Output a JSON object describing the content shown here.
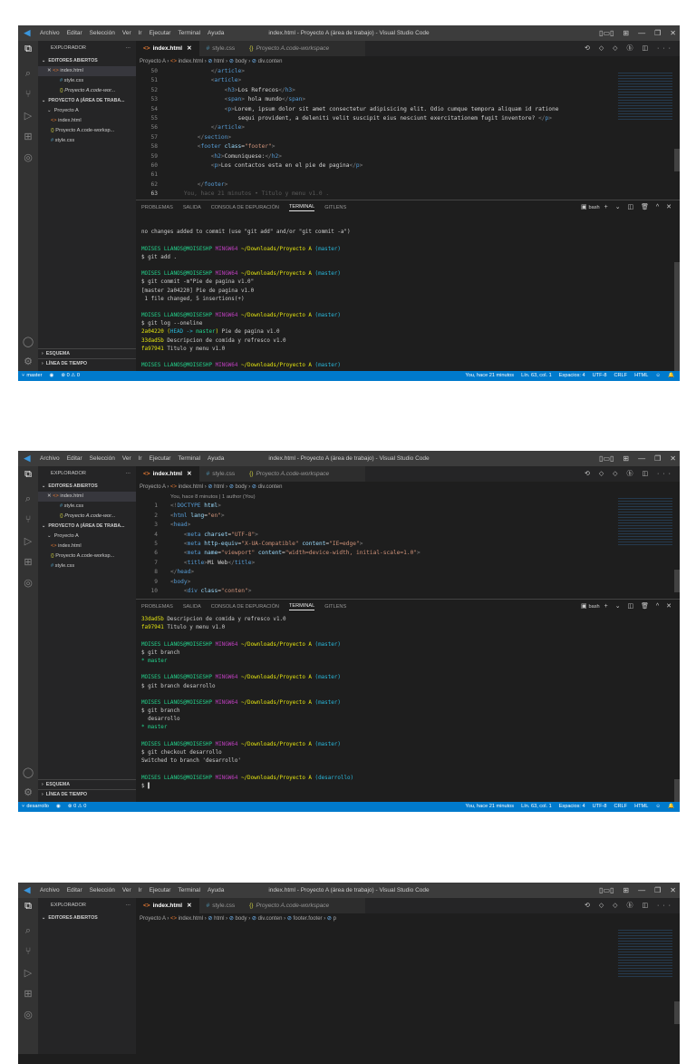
{
  "common": {
    "menu": [
      "Archivo",
      "Editar",
      "Selección",
      "Ver",
      "Ir",
      "Ejecutar",
      "Terminal",
      "Ayuda"
    ],
    "title": "index.html - Proyecto A (área de trabajo) - Visual Studio Code",
    "window_controls": [
      "▯▭▯",
      "⊞",
      "—",
      "❐",
      "✕"
    ],
    "tabs": [
      {
        "label": "index.html",
        "close": "✕",
        "icon": "<>"
      },
      {
        "label": "style.css",
        "icon": "#"
      },
      {
        "label": "Proyecto A.code-workspace",
        "icon": "{}"
      }
    ],
    "tab_actions": "⟲ ◇ ◇ ⓑ ◫ ···",
    "sidebar": {
      "explorer_title": "EXPLORADOR",
      "more": "···",
      "open_editors": "EDITORES ABIERTOS",
      "open_files": [
        "index.html",
        "style.css",
        "Proyecto A.code-wor..."
      ],
      "workspace": "PROYECTO A (ÁREA DE TRABA...",
      "folder": "Proyecto A",
      "folder_files": [
        "index.html",
        "Proyecto A.code-worksp...",
        "style.css"
      ],
      "outline": "ESQUEMA",
      "timeline": "LÍNEA DE TIEMPO"
    },
    "panel_tabs": [
      "PROBLEMAS",
      "SALIDA",
      "CONSOLA DE DEPURACIÓN",
      "TERMINAL",
      "GITLENS"
    ],
    "shell": "bash",
    "panel_actions": "+ ⌄ ◫ 🗑 ^ ✕",
    "status": {
      "errors": "⊗ 0 ⚠ 0",
      "blame": "You, hace 21 minutos",
      "position": "Lín. 63, col. 1",
      "spaces": "Espacios: 4",
      "encoding": "UTF-8",
      "eol": "CRLF",
      "language": "HTML"
    },
    "colors": {
      "status_bar": "#007acc",
      "titlebar": "#3c3c3c",
      "editor_bg": "#1e1e1e",
      "sidebar_bg": "#252526"
    }
  },
  "windows": [
    {
      "breadcrumb": [
        "Proyecto A",
        "index.html",
        "html",
        "body",
        "div.conten"
      ],
      "branch": "master",
      "code_header": "",
      "code": [
        {
          "n": "50",
          "s": [
            [
              "            </",
              "b"
            ],
            [
              "article",
              "t"
            ],
            [
              ">",
              "b"
            ]
          ]
        },
        {
          "n": "51",
          "s": [
            [
              "            <",
              "b"
            ],
            [
              "article",
              "t"
            ],
            [
              ">",
              "b"
            ]
          ]
        },
        {
          "n": "52",
          "s": [
            [
              "                <",
              "b"
            ],
            [
              "h3",
              "t"
            ],
            [
              ">",
              "b"
            ],
            [
              "Los Refrecos",
              "x"
            ],
            [
              "</",
              "b"
            ],
            [
              "h3",
              "t"
            ],
            [
              ">",
              "b"
            ]
          ]
        },
        {
          "n": "53",
          "s": [
            [
              "                <",
              "b"
            ],
            [
              "span",
              "t"
            ],
            [
              ">",
              "b"
            ],
            [
              " hola mundo",
              "x"
            ],
            [
              "</",
              "b"
            ],
            [
              "span",
              "t"
            ],
            [
              ">",
              "b"
            ]
          ]
        },
        {
          "n": "54",
          "s": [
            [
              "                <",
              "b"
            ],
            [
              "p",
              "t"
            ],
            [
              ">",
              "b"
            ],
            [
              "Lorem, ipsum dolor sit amet consectetur adipisicing elit. Odio cumque tempora aliquam id ratione",
              "x"
            ]
          ]
        },
        {
          "n": "55",
          "s": [
            [
              "                    sequi provident, a deleniti velit suscipit eius nesciunt exercitationem fugit inventore? ",
              "x"
            ],
            [
              "</",
              "b"
            ],
            [
              "p",
              "t"
            ],
            [
              ">",
              "b"
            ]
          ]
        },
        {
          "n": "56",
          "s": [
            [
              "            </",
              "b"
            ],
            [
              "article",
              "t"
            ],
            [
              ">",
              "b"
            ]
          ]
        },
        {
          "n": "57",
          "s": [
            [
              "        </",
              "b"
            ],
            [
              "section",
              "t"
            ],
            [
              ">",
              "b"
            ]
          ]
        },
        {
          "n": "58",
          "s": [
            [
              "        <",
              "b"
            ],
            [
              "footer",
              "t"
            ],
            [
              " class",
              "a"
            ],
            [
              "=",
              "x"
            ],
            [
              "\"footer\"",
              "s"
            ],
            [
              ">",
              "b"
            ]
          ]
        },
        {
          "n": "59",
          "s": [
            [
              "            <",
              "b"
            ],
            [
              "h2",
              "t"
            ],
            [
              ">",
              "b"
            ],
            [
              "Comuniquese:",
              "x"
            ],
            [
              "</",
              "b"
            ],
            [
              "h2",
              "t"
            ],
            [
              ">",
              "b"
            ]
          ]
        },
        {
          "n": "60",
          "s": [
            [
              "            <",
              "b"
            ],
            [
              "p",
              "t"
            ],
            [
              ">",
              "b"
            ],
            [
              "Los contactos esta en el pie de pagina",
              "x"
            ],
            [
              "</",
              "b"
            ],
            [
              "p",
              "t"
            ],
            [
              ">",
              "b"
            ]
          ]
        },
        {
          "n": "61",
          "s": []
        },
        {
          "n": "62",
          "s": [
            [
              "        </",
              "b"
            ],
            [
              "footer",
              "t"
            ],
            [
              ">",
              "b"
            ]
          ]
        },
        {
          "n": "63",
          "s": [
            [
              "    You, hace 21 minutos • Titulo y menu v1.0 .",
              "gh"
            ]
          ]
        }
      ],
      "terminal": [
        [],
        [
          [
            "no changes added to commit (use \"git add\" and/or \"git commit -a\")",
            "w"
          ]
        ],
        [],
        [
          [
            "MOISES LLANOS@MOISESHP ",
            "g"
          ],
          [
            "MINGW64 ",
            "m"
          ],
          [
            "~/Downloads/Proyecto A ",
            "y"
          ],
          [
            "(master)",
            "c"
          ]
        ],
        [
          [
            "$ git add .",
            "w"
          ]
        ],
        [],
        [
          [
            "MOISES LLANOS@MOISESHP ",
            "g"
          ],
          [
            "MINGW64 ",
            "m"
          ],
          [
            "~/Downloads/Proyecto A ",
            "y"
          ],
          [
            "(master)",
            "c"
          ]
        ],
        [
          [
            "$ git commit -m\"Pie de pagina v1.0\"",
            "w"
          ]
        ],
        [
          [
            "[master 2a04220] Pie de pagina v1.0",
            "w"
          ]
        ],
        [
          [
            " 1 file changed, 5 insertions(+)",
            "w"
          ]
        ],
        [],
        [
          [
            "MOISES LLANOS@MOISESHP ",
            "g"
          ],
          [
            "MINGW64 ",
            "m"
          ],
          [
            "~/Downloads/Proyecto A ",
            "y"
          ],
          [
            "(master)",
            "c"
          ]
        ],
        [
          [
            "$ git log --oneline",
            "w"
          ]
        ],
        [
          [
            "2a04220",
            "h"
          ],
          [
            " (",
            "y"
          ],
          [
            "HEAD -> ",
            "c"
          ],
          [
            "master",
            "g"
          ],
          [
            ")",
            "y"
          ],
          [
            " Pie de pagina v1.0",
            "w"
          ]
        ],
        [
          [
            "33dad5b",
            "h"
          ],
          [
            " Descripcion de comida y refresco v1.0",
            "w"
          ]
        ],
        [
          [
            "fa97941",
            "h"
          ],
          [
            " Titulo y menu v1.0",
            "w"
          ]
        ],
        [],
        [
          [
            "MOISES LLANOS@MOISESHP ",
            "g"
          ],
          [
            "MINGW64 ",
            "m"
          ],
          [
            "~/Downloads/Proyecto A ",
            "y"
          ],
          [
            "(master)",
            "c"
          ]
        ]
      ]
    },
    {
      "breadcrumb": [
        "Proyecto A",
        "index.html",
        "html",
        "body",
        "div.conten"
      ],
      "branch": "desarrollo",
      "code_header": "You, hace 8 minutos | 1 author (You)",
      "code": [
        {
          "n": "1",
          "s": [
            [
              "<!",
              "b"
            ],
            [
              "DOCTYPE",
              "t"
            ],
            [
              " html",
              "k"
            ],
            [
              ">",
              "b"
            ]
          ]
        },
        {
          "n": "2",
          "s": [
            [
              "<",
              "b"
            ],
            [
              "html",
              "t"
            ],
            [
              " lang",
              "a"
            ],
            [
              "=",
              "x"
            ],
            [
              "\"en\"",
              "s"
            ],
            [
              ">",
              "b"
            ]
          ]
        },
        {
          "n": "3",
          "s": [
            [
              "<",
              "b"
            ],
            [
              "head",
              "t"
            ],
            [
              ">",
              "b"
            ]
          ]
        },
        {
          "n": "4",
          "s": [
            [
              "    <",
              "b"
            ],
            [
              "meta",
              "t"
            ],
            [
              " charset",
              "a"
            ],
            [
              "=",
              "x"
            ],
            [
              "\"UTF-8\"",
              "s"
            ],
            [
              ">",
              "b"
            ]
          ]
        },
        {
          "n": "5",
          "s": [
            [
              "    <",
              "b"
            ],
            [
              "meta",
              "t"
            ],
            [
              " http-equiv",
              "a"
            ],
            [
              "=",
              "x"
            ],
            [
              "\"X-UA-Compatible\"",
              "s"
            ],
            [
              " content",
              "a"
            ],
            [
              "=",
              "x"
            ],
            [
              "\"IE=edge\"",
              "s"
            ],
            [
              ">",
              "b"
            ]
          ]
        },
        {
          "n": "6",
          "s": [
            [
              "    <",
              "b"
            ],
            [
              "meta",
              "t"
            ],
            [
              " name",
              "a"
            ],
            [
              "=",
              "x"
            ],
            [
              "\"viewport\"",
              "s"
            ],
            [
              " content",
              "a"
            ],
            [
              "=",
              "x"
            ],
            [
              "\"width=device-width, initial-scale=1.0\"",
              "s"
            ],
            [
              ">",
              "b"
            ]
          ]
        },
        {
          "n": "7",
          "s": [
            [
              "    <",
              "b"
            ],
            [
              "title",
              "t"
            ],
            [
              ">",
              "b"
            ],
            [
              "Mi Web",
              "x"
            ],
            [
              "</",
              "b"
            ],
            [
              "title",
              "t"
            ],
            [
              ">",
              "b"
            ]
          ]
        },
        {
          "n": "8",
          "s": [
            [
              "</",
              "b"
            ],
            [
              "head",
              "t"
            ],
            [
              ">",
              "b"
            ]
          ]
        },
        {
          "n": "9",
          "s": [
            [
              "<",
              "b"
            ],
            [
              "body",
              "t"
            ],
            [
              ">",
              "b"
            ]
          ]
        },
        {
          "n": "10",
          "s": [
            [
              "    <",
              "b"
            ],
            [
              "div",
              "t"
            ],
            [
              " class",
              "a"
            ],
            [
              "=",
              "x"
            ],
            [
              "\"conten\"",
              "s"
            ],
            [
              ">",
              "b"
            ]
          ]
        }
      ],
      "terminal": [
        [
          [
            "33dad5b",
            "h"
          ],
          [
            " Descripcion de comida y refresco v1.0",
            "w"
          ]
        ],
        [
          [
            "fa97941",
            "h"
          ],
          [
            " Titulo y menu v1.0",
            "w"
          ]
        ],
        [],
        [
          [
            "MOISES LLANOS@MOISESHP ",
            "g"
          ],
          [
            "MINGW64 ",
            "m"
          ],
          [
            "~/Downloads/Proyecto A ",
            "y"
          ],
          [
            "(master)",
            "c"
          ]
        ],
        [
          [
            "$ git branch",
            "w"
          ]
        ],
        [
          [
            "* master",
            "grn"
          ]
        ],
        [],
        [
          [
            "MOISES LLANOS@MOISESHP ",
            "g"
          ],
          [
            "MINGW64 ",
            "m"
          ],
          [
            "~/Downloads/Proyecto A ",
            "y"
          ],
          [
            "(master)",
            "c"
          ]
        ],
        [
          [
            "$ git branch desarrollo",
            "w"
          ]
        ],
        [],
        [
          [
            "MOISES LLANOS@MOISESHP ",
            "g"
          ],
          [
            "MINGW64 ",
            "m"
          ],
          [
            "~/Downloads/Proyecto A ",
            "y"
          ],
          [
            "(master)",
            "c"
          ]
        ],
        [
          [
            "$ git branch",
            "w"
          ]
        ],
        [
          [
            "  desarrollo",
            "w"
          ]
        ],
        [
          [
            "* master",
            "grn"
          ]
        ],
        [],
        [
          [
            "MOISES LLANOS@MOISESHP ",
            "g"
          ],
          [
            "MINGW64 ",
            "m"
          ],
          [
            "~/Downloads/Proyecto A ",
            "y"
          ],
          [
            "(master)",
            "c"
          ]
        ],
        [
          [
            "$ git checkout desarrollo",
            "w"
          ]
        ],
        [
          [
            "Switched to branch 'desarrollo'",
            "w"
          ]
        ],
        [],
        [
          [
            "MOISES LLANOS@MOISESHP ",
            "g"
          ],
          [
            "MINGW64 ",
            "m"
          ],
          [
            "~/Downloads/Proyecto A ",
            "y"
          ],
          [
            "(desarrollo)",
            "c"
          ]
        ],
        [
          [
            "$ ▌",
            "w"
          ]
        ]
      ]
    },
    {
      "breadcrumb": [
        "Proyecto A",
        "index.html",
        "html",
        "body",
        "div.conten",
        "footer.footer",
        "p"
      ],
      "code_header": "",
      "code": [],
      "terminal": []
    }
  ]
}
